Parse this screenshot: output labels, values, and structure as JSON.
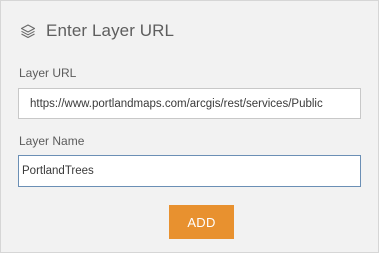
{
  "panel": {
    "title": "Enter Layer URL",
    "header_icon": "layers-icon"
  },
  "url_field": {
    "label": "Layer URL",
    "value": "https://www.portlandmaps.com/arcgis/rest/services/Public"
  },
  "name_field": {
    "label": "Layer Name",
    "value": "PortlandTrees"
  },
  "add_button": {
    "label": "ADD",
    "color": "#e8912f"
  }
}
